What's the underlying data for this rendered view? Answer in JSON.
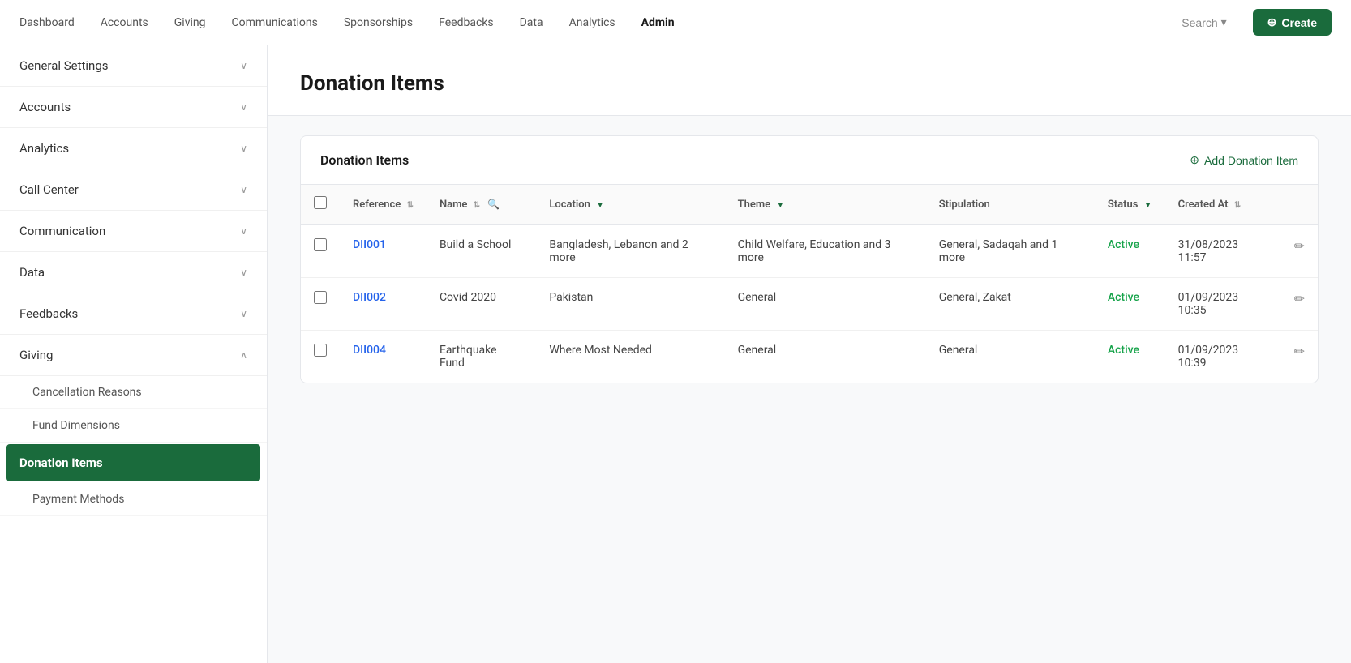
{
  "nav": {
    "items": [
      {
        "label": "Dashboard",
        "active": false
      },
      {
        "label": "Accounts",
        "active": false
      },
      {
        "label": "Giving",
        "active": false
      },
      {
        "label": "Communications",
        "active": false
      },
      {
        "label": "Sponsorships",
        "active": false
      },
      {
        "label": "Feedbacks",
        "active": false
      },
      {
        "label": "Data",
        "active": false
      },
      {
        "label": "Analytics",
        "active": false
      },
      {
        "label": "Admin",
        "active": true
      }
    ],
    "search_label": "Search",
    "create_label": "Create"
  },
  "sidebar": {
    "items": [
      {
        "label": "General Settings",
        "expanded": false,
        "hasChevron": true
      },
      {
        "label": "Accounts",
        "expanded": false,
        "hasChevron": true
      },
      {
        "label": "Analytics",
        "expanded": false,
        "hasChevron": true
      },
      {
        "label": "Call Center",
        "expanded": false,
        "hasChevron": true
      },
      {
        "label": "Communication",
        "expanded": false,
        "hasChevron": true
      },
      {
        "label": "Data",
        "expanded": false,
        "hasChevron": true
      },
      {
        "label": "Feedbacks",
        "expanded": false,
        "hasChevron": true
      },
      {
        "label": "Giving",
        "expanded": true,
        "hasChevron": true
      }
    ],
    "giving_subitems": [
      {
        "label": "Cancellation Reasons",
        "active": false
      },
      {
        "label": "Fund Dimensions",
        "active": false
      },
      {
        "label": "Donation Items",
        "active": true
      },
      {
        "label": "Payment Methods",
        "active": false
      }
    ]
  },
  "page": {
    "title": "Donation Items"
  },
  "table": {
    "section_title": "Donation Items",
    "add_button_label": "Add Donation Item",
    "columns": [
      "Reference",
      "Name",
      "Location",
      "Theme",
      "Stipulation",
      "Status",
      "Created At"
    ],
    "rows": [
      {
        "ref": "DII001",
        "name": "Build a School",
        "location": "Bangladesh, Lebanon and 2 more",
        "theme": "Child Welfare, Education and 3 more",
        "stipulation": "General, Sadaqah and 1 more",
        "status": "Active",
        "created_at": "31/08/2023 11:57"
      },
      {
        "ref": "DII002",
        "name": "Covid 2020",
        "location": "Pakistan",
        "theme": "General",
        "stipulation": "General, Zakat",
        "status": "Active",
        "created_at": "01/09/2023 10:35"
      },
      {
        "ref": "DII004",
        "name": "Earthquake Fund",
        "location": "Where Most Needed",
        "theme": "General",
        "stipulation": "General",
        "status": "Active",
        "created_at": "01/09/2023 10:39"
      }
    ]
  }
}
